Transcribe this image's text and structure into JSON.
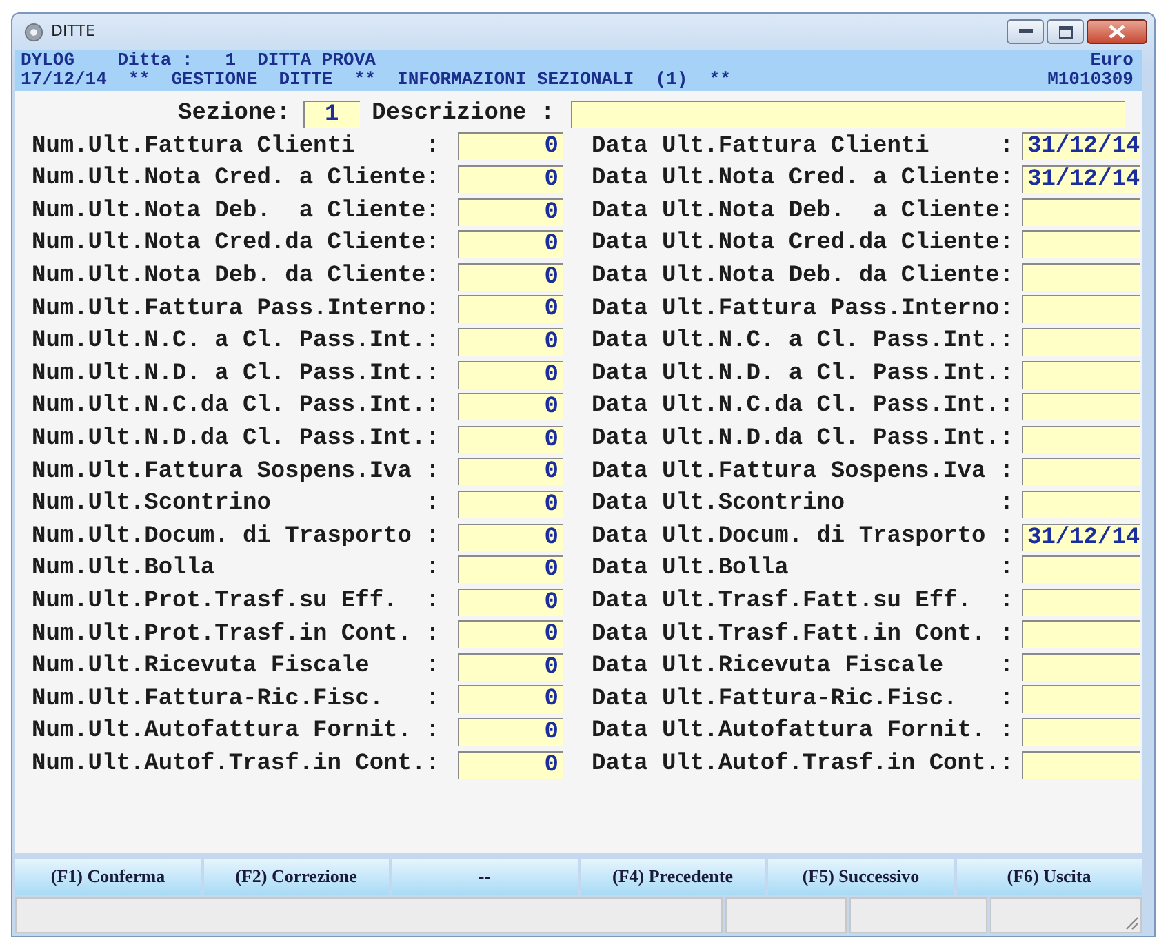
{
  "window": {
    "title": "DITTE"
  },
  "header": {
    "line_1": "DYLOG    Ditta :   1  DITTA PROVA",
    "line_1_right": "Euro",
    "line_2": "17/12/14  **  GESTIONE  DITTE  **  INFORMAZIONI SEZIONALI  (1)  **",
    "line_2_right": "M1010309"
  },
  "section": {
    "label": "Sezione:",
    "value": "1",
    "description_label": "Descrizione :"
  },
  "rows": [
    {
      "num_label": "Num.Ult.Fattura Clienti     :",
      "num_value": "0",
      "date_label": "Data Ult.Fattura Clienti     :",
      "date_value": "31/12/14"
    },
    {
      "num_label": "Num.Ult.Nota Cred. a Cliente:",
      "num_value": "0",
      "date_label": "Data Ult.Nota Cred. a Cliente:",
      "date_value": "31/12/14"
    },
    {
      "num_label": "Num.Ult.Nota Deb.  a Cliente:",
      "num_value": "0",
      "date_label": "Data Ult.Nota Deb.  a Cliente:"
    },
    {
      "num_label": "Num.Ult.Nota Cred.da Cliente:",
      "num_value": "0",
      "date_label": "Data Ult.Nota Cred.da Cliente:"
    },
    {
      "num_label": "Num.Ult.Nota Deb. da Cliente:",
      "num_value": "0",
      "date_label": "Data Ult.Nota Deb. da Cliente:"
    },
    {
      "num_label": "Num.Ult.Fattura Pass.Interno:",
      "num_value": "0",
      "date_label": "Data Ult.Fattura Pass.Interno:"
    },
    {
      "num_label": "Num.Ult.N.C. a Cl. Pass.Int.:",
      "num_value": "0",
      "date_label": "Data Ult.N.C. a Cl. Pass.Int.:"
    },
    {
      "num_label": "Num.Ult.N.D. a Cl. Pass.Int.:",
      "num_value": "0",
      "date_label": "Data Ult.N.D. a Cl. Pass.Int.:"
    },
    {
      "num_label": "Num.Ult.N.C.da Cl. Pass.Int.:",
      "num_value": "0",
      "date_label": "Data Ult.N.C.da Cl. Pass.Int.:"
    },
    {
      "num_label": "Num.Ult.N.D.da Cl. Pass.Int.:",
      "num_value": "0",
      "date_label": "Data Ult.N.D.da Cl. Pass.Int.:"
    },
    {
      "num_label": "Num.Ult.Fattura Sospens.Iva :",
      "num_value": "0",
      "date_label": "Data Ult.Fattura Sospens.Iva :"
    },
    {
      "num_label": "Num.Ult.Scontrino           :",
      "num_value": "0",
      "date_label": "Data Ult.Scontrino           :"
    },
    {
      "num_label": "Num.Ult.Docum. di Trasporto :",
      "num_value": "0",
      "date_label": "Data Ult.Docum. di Trasporto :",
      "date_value": "31/12/14"
    },
    {
      "num_label": "Num.Ult.Bolla               :",
      "num_value": "0",
      "date_label": "Data Ult.Bolla               :"
    },
    {
      "num_label": "Num.Ult.Prot.Trasf.su Eff.  :",
      "num_value": "0",
      "date_label": "Data Ult.Trasf.Fatt.su Eff.  :"
    },
    {
      "num_label": "Num.Ult.Prot.Trasf.in Cont. :",
      "num_value": "0",
      "date_label": "Data Ult.Trasf.Fatt.in Cont. :"
    },
    {
      "num_label": "Num.Ult.Ricevuta Fiscale    :",
      "num_value": "0",
      "date_label": "Data Ult.Ricevuta Fiscale    :"
    },
    {
      "num_label": "Num.Ult.Fattura-Ric.Fisc.   :",
      "num_value": "0",
      "date_label": "Data Ult.Fattura-Ric.Fisc.   :"
    },
    {
      "num_label": "Num.Ult.Autofattura Fornit. :",
      "num_value": "0",
      "date_label": "Data Ult.Autofattura Fornit. :"
    },
    {
      "num_label": "Num.Ult.Autof.Trasf.in Cont.:",
      "num_value": "0",
      "date_label": "Data Ult.Autof.Trasf.in Cont.:"
    }
  ],
  "function_keys": [
    "(F1) Conferma",
    "(F2) Correzione",
    "--",
    "(F4) Precedente",
    "(F5) Successivo",
    "(F6) Uscita"
  ]
}
